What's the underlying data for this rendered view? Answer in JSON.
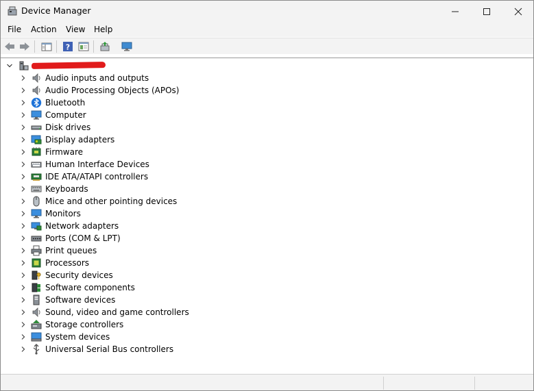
{
  "window": {
    "title": "Device Manager"
  },
  "menu": [
    "File",
    "Action",
    "View",
    "Help"
  ],
  "toolbar": [
    {
      "name": "back-icon"
    },
    {
      "name": "forward-icon"
    },
    {
      "name": "show-hide-console-tree-icon"
    },
    {
      "name": "help-icon"
    },
    {
      "name": "properties-icon"
    },
    {
      "name": "update-driver-icon"
    },
    {
      "name": "scan-hardware-icon"
    }
  ],
  "tree": {
    "root": {
      "label_redacted": true,
      "icon": "computer-root-icon"
    },
    "categories": [
      {
        "label": "Audio inputs and outputs",
        "icon": "speaker-icon"
      },
      {
        "label": "Audio Processing Objects (APOs)",
        "icon": "speaker-icon"
      },
      {
        "label": "Bluetooth",
        "icon": "bluetooth-icon"
      },
      {
        "label": "Computer",
        "icon": "monitor-icon"
      },
      {
        "label": "Disk drives",
        "icon": "disk-drive-icon"
      },
      {
        "label": "Display adapters",
        "icon": "display-adapter-icon"
      },
      {
        "label": "Firmware",
        "icon": "firmware-icon"
      },
      {
        "label": "Human Interface Devices",
        "icon": "hid-icon"
      },
      {
        "label": "IDE ATA/ATAPI controllers",
        "icon": "ide-controller-icon"
      },
      {
        "label": "Keyboards",
        "icon": "keyboard-icon"
      },
      {
        "label": "Mice and other pointing devices",
        "icon": "mouse-icon"
      },
      {
        "label": "Monitors",
        "icon": "monitor-icon"
      },
      {
        "label": "Network adapters",
        "icon": "network-icon"
      },
      {
        "label": "Ports (COM & LPT)",
        "icon": "port-icon"
      },
      {
        "label": "Print queues",
        "icon": "printer-icon"
      },
      {
        "label": "Processors",
        "icon": "processor-icon"
      },
      {
        "label": "Security devices",
        "icon": "security-device-icon"
      },
      {
        "label": "Software components",
        "icon": "software-component-icon"
      },
      {
        "label": "Software devices",
        "icon": "software-device-icon"
      },
      {
        "label": "Sound, video and game controllers",
        "icon": "speaker-icon"
      },
      {
        "label": "Storage controllers",
        "icon": "storage-controller-icon"
      },
      {
        "label": "System devices",
        "icon": "system-device-icon"
      },
      {
        "label": "Universal Serial Bus controllers",
        "icon": "usb-icon"
      }
    ]
  }
}
